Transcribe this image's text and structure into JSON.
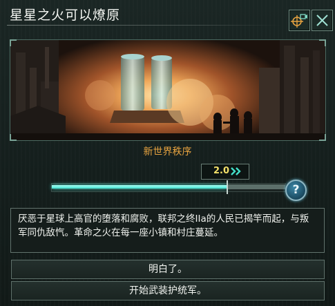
{
  "dialog": {
    "title": "星星之火可以燎原",
    "event_name": "新世界秩序",
    "speed_value": "2.0",
    "speed_icon": "fast-forward-icon",
    "progress_fraction": 0.75,
    "help_label": "?",
    "description": "厌恶于星球上高官的堕落和腐败，联邦之终IIa的人民已揭竿而起，与叛军同仇敌忾。革命之火在每一座小镇和村庄蔓延。",
    "choices": [
      "明白了。",
      "开始武装护统军。"
    ]
  },
  "toolbar": {
    "camera_icon": "locate-camera-icon",
    "close_icon": "close-icon"
  },
  "colors": {
    "accent_orange": "#e7a340",
    "accent_teal": "#42e0cf",
    "speed_yellow": "#f3e06a"
  }
}
